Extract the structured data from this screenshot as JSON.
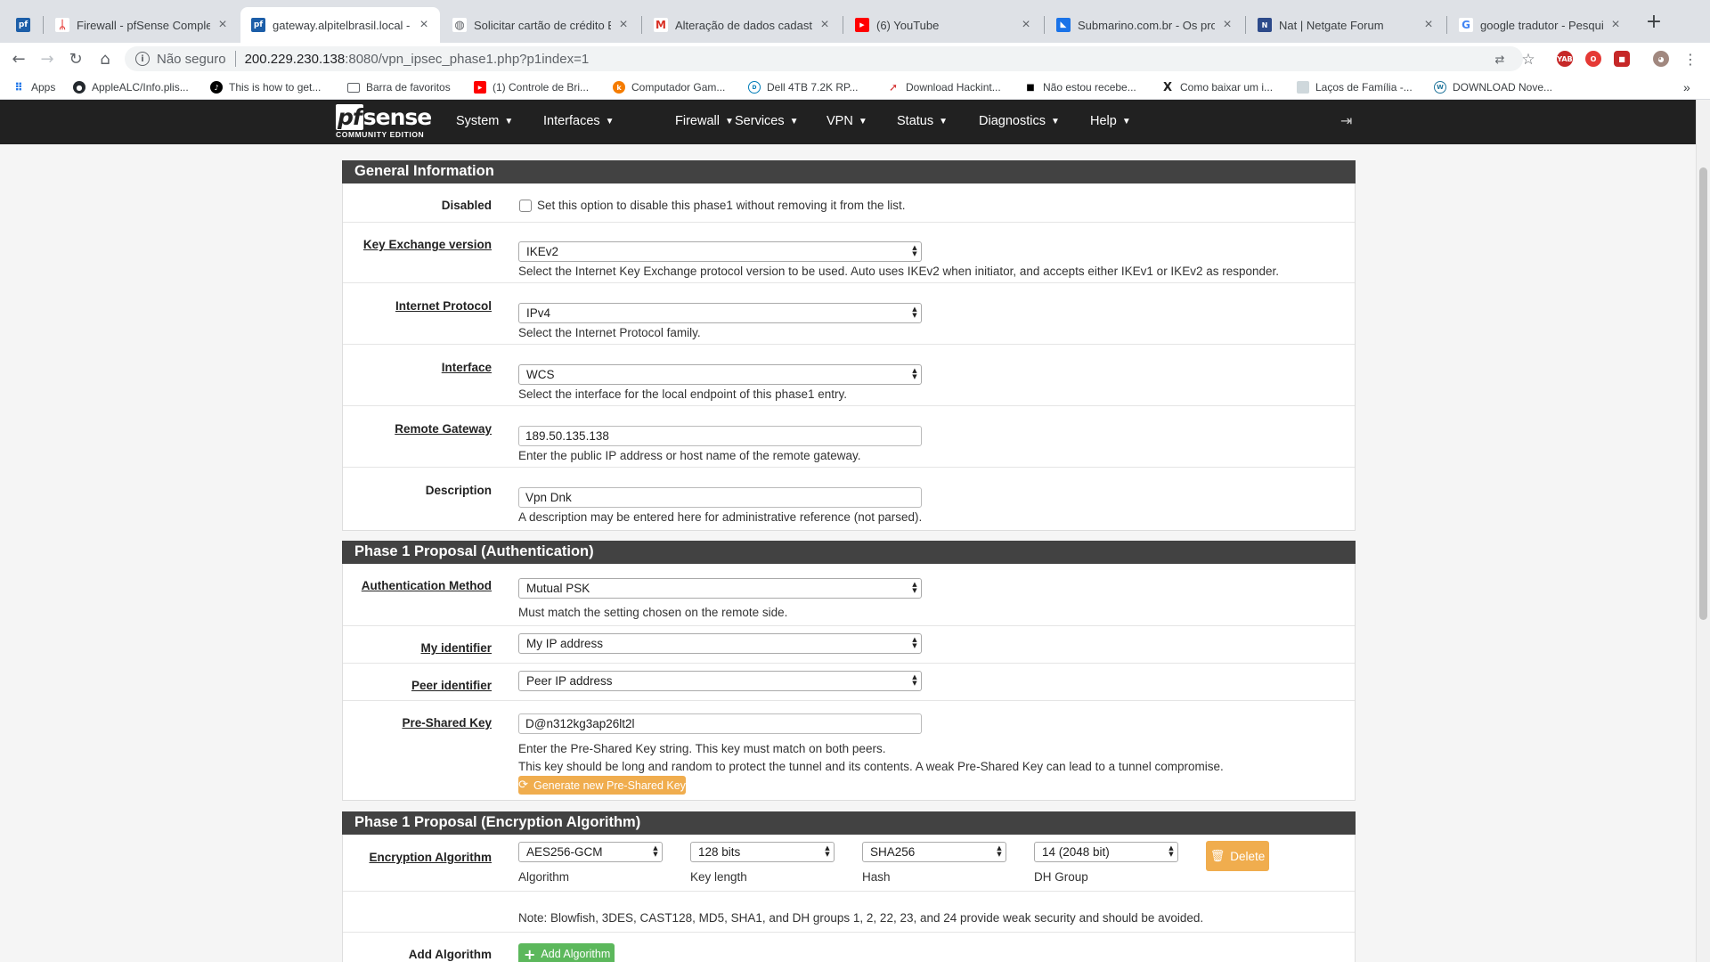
{
  "browser": {
    "tabs": [
      {
        "favicon": "pfsense-icon",
        "title": ""
      },
      {
        "favicon": "pdf-icon",
        "title": "Firewall - pfSense Complete"
      },
      {
        "favicon": "pfsense-icon",
        "title": "gateway.alpitelbrasil.local -",
        "active": true
      },
      {
        "favicon": "globe-icon",
        "title": "Solicitar cartão de crédito B"
      },
      {
        "favicon": "gmail-icon",
        "title": "Alteração de dados cadastr"
      },
      {
        "favicon": "youtube-icon",
        "title": "(6) YouTube"
      },
      {
        "favicon": "submarino-icon",
        "title": "Submarino.com.br - Os prod"
      },
      {
        "favicon": "netgate-icon",
        "title": "Nat | Netgate Forum"
      },
      {
        "favicon": "google-icon",
        "title": "google tradutor - Pesquisa G"
      }
    ],
    "address": {
      "security": "Não seguro",
      "host": "200.229.230.138",
      "path": ":8080/vpn_ipsec_phase1.php?p1index=1"
    },
    "bookmarks": [
      {
        "icon": "apps-icon",
        "label": "Apps"
      },
      {
        "icon": "github-icon",
        "label": "AppleALC/Info.plis..."
      },
      {
        "icon": "tiktok-icon",
        "label": "This is how to get..."
      },
      {
        "icon": "folder-icon",
        "label": "Barra de favoritos"
      },
      {
        "icon": "youtube-icon",
        "label": "(1) Controle de Bri..."
      },
      {
        "icon": "kabum-icon",
        "label": "Computador Gam..."
      },
      {
        "icon": "dell-icon",
        "label": "Dell 4TB 7.2K RP..."
      },
      {
        "icon": "download-icon",
        "label": "Download Hackint..."
      },
      {
        "icon": "square-icon",
        "label": "Não estou recebe..."
      },
      {
        "icon": "x-icon",
        "label": "Como baixar um i..."
      },
      {
        "icon": "page-icon",
        "label": "Laços de Família -..."
      },
      {
        "icon": "wordpress-icon",
        "label": "DOWNLOAD Nove..."
      }
    ],
    "more_bookmarks": "»"
  },
  "pfsense": {
    "logo": {
      "pf": "pf",
      "sense": "sense",
      "edition": "COMMUNITY EDITION"
    },
    "menu": [
      "System",
      "Interfaces",
      "Firewall",
      "Services",
      "VPN",
      "Status",
      "Diagnostics",
      "Help"
    ]
  },
  "general": {
    "heading": "General Information",
    "disabled": {
      "label": "Disabled",
      "checked": false,
      "text": "Set this option to disable this phase1 without removing it from the list."
    },
    "key_exchange": {
      "label": "Key Exchange version",
      "value": "IKEv2",
      "help": "Select the Internet Key Exchange protocol version to be used. Auto uses IKEv2 when initiator, and accepts either IKEv1 or IKEv2 as responder."
    },
    "protocol": {
      "label": "Internet Protocol",
      "value": "IPv4",
      "help": "Select the Internet Protocol family."
    },
    "interface": {
      "label": "Interface",
      "value": "WCS",
      "help": "Select the interface for the local endpoint of this phase1 entry."
    },
    "remote_gateway": {
      "label": "Remote Gateway",
      "value": "189.50.135.138",
      "help": "Enter the public IP address or host name of the remote gateway."
    },
    "description": {
      "label": "Description",
      "value": "Vpn Dnk",
      "help": "A description may be entered here for administrative reference (not parsed)."
    }
  },
  "auth": {
    "heading": "Phase 1 Proposal (Authentication)",
    "method": {
      "label": "Authentication Method",
      "value": "Mutual PSK",
      "help": "Must match the setting chosen on the remote side."
    },
    "my_id": {
      "label": "My identifier",
      "value": "My IP address"
    },
    "peer_id": {
      "label": "Peer identifier",
      "value": "Peer IP address"
    },
    "psk": {
      "label": "Pre-Shared Key",
      "value": "D@n312kg3ap26lt2l",
      "help1": "Enter the Pre-Shared Key string. This key must match on both peers.",
      "help2": "This key should be long and random to protect the tunnel and its contents. A weak Pre-Shared Key can lead to a tunnel compromise.",
      "generate_label": "Generate new Pre-Shared Key"
    }
  },
  "encryption": {
    "heading": "Phase 1 Proposal (Encryption Algorithm)",
    "label": "Encryption Algorithm",
    "algorithm": {
      "value": "AES256-GCM",
      "caption": "Algorithm"
    },
    "key_length": {
      "value": "128 bits",
      "caption": "Key length"
    },
    "hash": {
      "value": "SHA256",
      "caption": "Hash"
    },
    "dh_group": {
      "value": "14 (2048 bit)",
      "caption": "DH Group"
    },
    "delete_label": "Delete",
    "note": "Note: Blowfish, 3DES, CAST128, MD5, SHA1, and DH groups 1, 2, 22, 23, and 24 provide weak security and should be avoided.",
    "add_label": "Add Algorithm",
    "add_button": "Add Algorithm"
  },
  "colors": {
    "navbar": "#212121",
    "panel_heading": "#424242",
    "warning": "#f0ad4e",
    "success": "#5cb85c"
  }
}
